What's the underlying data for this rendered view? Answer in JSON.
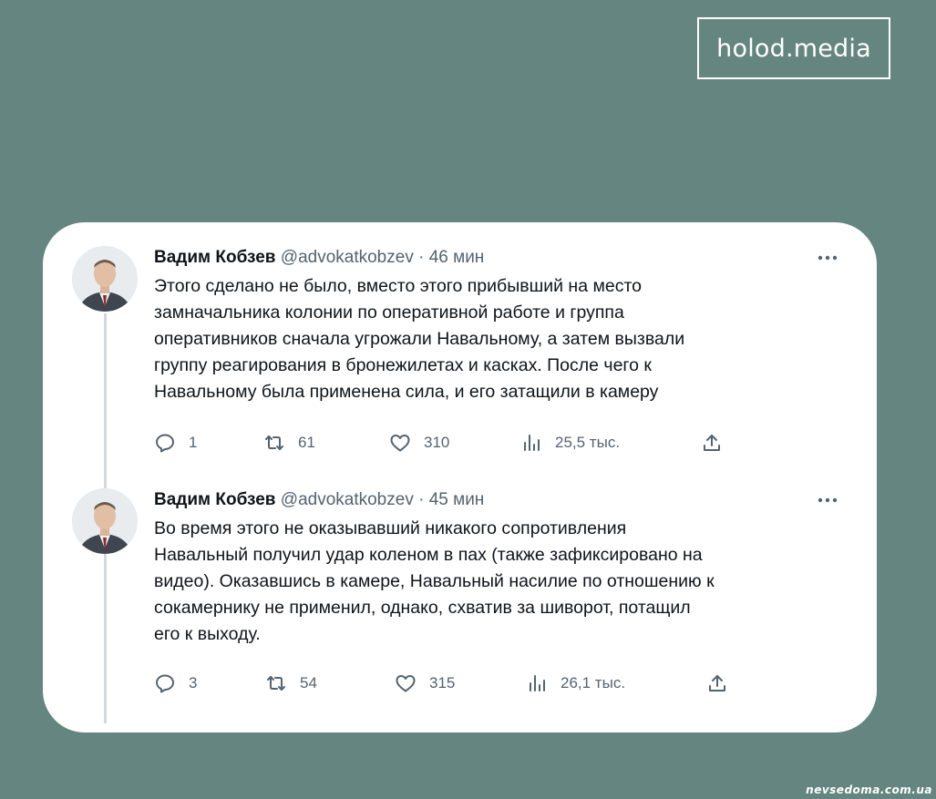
{
  "brand": {
    "label": "holod.media"
  },
  "tweets": [
    {
      "author_name": "Вадим Кобзев",
      "handle": "@advokatkobzev",
      "separator": "·",
      "time": "46 мин",
      "lines": [
        "Этого сделано не было, вместо этого прибывший на место",
        "замначальника колонии по оперативной работе и группа",
        "оперативников сначала угрожали Навальному, а затем вызвали",
        "группу реагирования в бронежилетах и касках. После чего к",
        "Навальному была применена сила, и его затащили в камеру"
      ],
      "replies": "1",
      "retweets": "61",
      "likes": "310",
      "views": "25,5 тыс."
    },
    {
      "author_name": "Вадим Кобзев",
      "handle": "@advokatkobzev",
      "separator": "·",
      "time": "45 мин",
      "lines": [
        "Во время этого не оказывавший никакого сопротивления",
        "Навальный получил удар коленом в пах (также зафиксировано на",
        "видео). Оказавшись в камере, Навальный насилие по отношению к",
        "сокамернику не применил, однако, схватив за шиворот, потащил",
        "его к выходу."
      ],
      "replies": "3",
      "retweets": "54",
      "likes": "315",
      "views": "26,1 тыс."
    }
  ],
  "watermark": {
    "text": "nevsedoma.com.ua"
  },
  "colors": {
    "background": "#658580",
    "card": "#ffffff",
    "text_primary": "#0f1419",
    "text_secondary": "#536471"
  },
  "icons": [
    "more-icon",
    "reply-icon",
    "retweet-icon",
    "like-icon",
    "views-icon",
    "share-icon"
  ]
}
